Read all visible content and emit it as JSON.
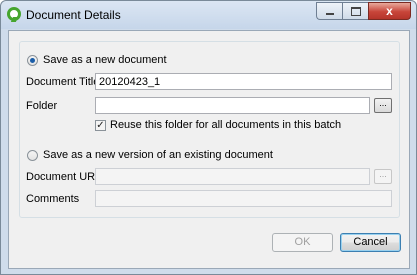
{
  "window": {
    "title": "Document Details",
    "close_label": "x",
    "minimize_label": "",
    "maximize_label": ""
  },
  "new_document": {
    "option_label": "Save as a new document",
    "selected": true,
    "title_label": "Document Title",
    "title_value": "20120423_1",
    "folder_label": "Folder",
    "folder_value": "",
    "folder_browse_label": "...",
    "reuse_folder_label": "Reuse this folder for all documents in this batch",
    "reuse_folder_checked": true
  },
  "new_version": {
    "option_label": "Save as a new version of an existing document",
    "selected": false,
    "url_label": "Document URL",
    "url_value": "",
    "url_browse_label": "...",
    "comments_label": "Comments",
    "comments_value": ""
  },
  "buttons": {
    "ok_label": "OK",
    "cancel_label": "Cancel"
  }
}
